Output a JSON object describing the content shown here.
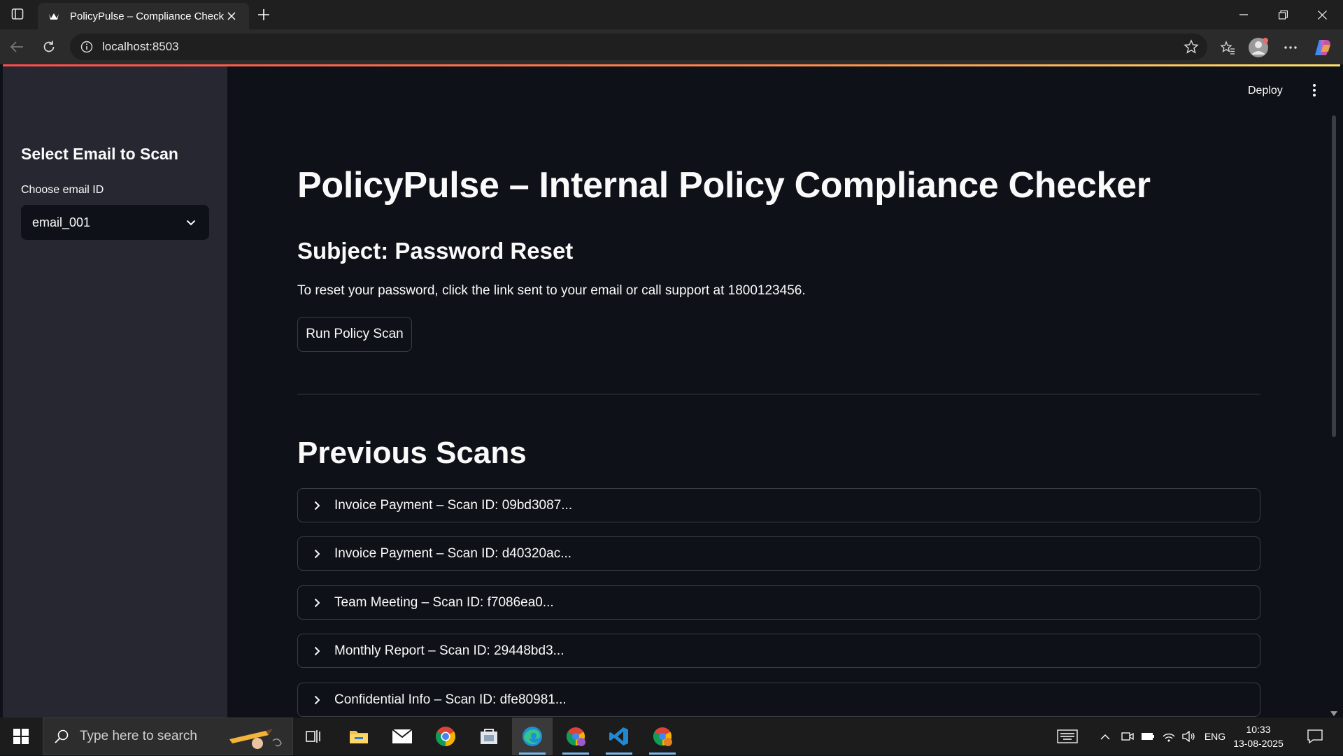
{
  "browser": {
    "tab_title": "PolicyPulse – Compliance Checker",
    "url": "localhost:8503"
  },
  "app": {
    "deploy_label": "Deploy",
    "title": "PolicyPulse – Internal Policy Compliance Checker",
    "subject": "Subject: Password Reset",
    "body": "To reset your password, click the link sent to your email or call support at 1800123456.",
    "scan_button": "Run Policy Scan",
    "previous_title": "Previous Scans",
    "previous_scans": [
      "Invoice Payment – Scan ID: 09bd3087...",
      "Invoice Payment – Scan ID: d40320ac...",
      "Team Meeting – Scan ID: f7086ea0...",
      "Monthly Report – Scan ID: 29448bd3...",
      "Confidential Info – Scan ID: dfe80981..."
    ]
  },
  "sidebar": {
    "title": "Select Email to Scan",
    "select_label": "Choose email ID",
    "select_value": "email_001"
  },
  "taskbar": {
    "search_placeholder": "Type here to search",
    "language": "ENG",
    "time": "10:33",
    "date": "13-08-2025"
  },
  "colors": {
    "accent": "#ff4b4b",
    "background": "#0e1117",
    "sidebar": "#262730"
  }
}
